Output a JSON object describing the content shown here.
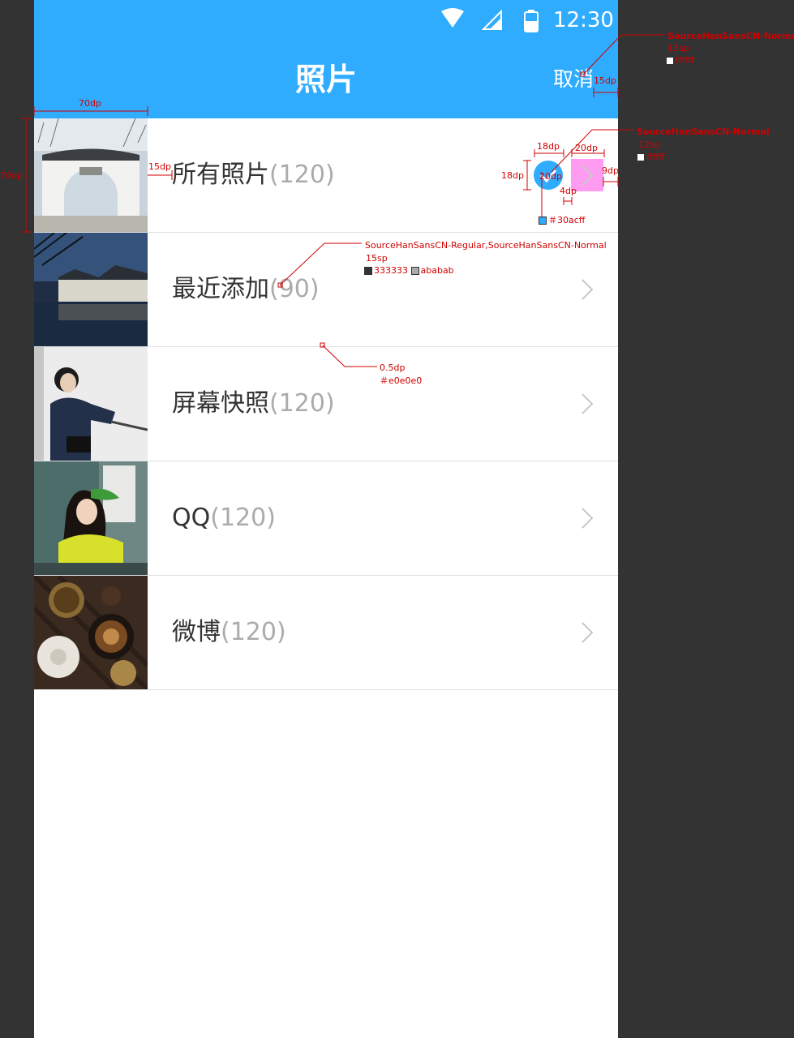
{
  "status_bar": {
    "time": "12:30",
    "icons": [
      "wifi-icon",
      "signal-icon",
      "battery-icon"
    ]
  },
  "header": {
    "title": "照片",
    "cancel_label": "取消"
  },
  "colors": {
    "accent": "#30acff",
    "primary_text": "#333333",
    "secondary_text": "#ababab",
    "divider": "#e0e0e0",
    "header_text": "#ffffff"
  },
  "albums": [
    {
      "name": "所有照片",
      "count": "(120)",
      "selected": true
    },
    {
      "name": "最近添加",
      "count": "(90)",
      "selected": false
    },
    {
      "name": "屏幕快照",
      "count": "(120)",
      "selected": false
    },
    {
      "name": "QQ",
      "count": "(120)",
      "selected": false
    },
    {
      "name": "微博",
      "count": "(120)",
      "selected": false
    }
  ],
  "annotations": {
    "cancel_font": "SourceHanSansCN-Normal",
    "cancel_size": "13sp",
    "cancel_color": "ffffff",
    "badge_font": "SourceHanSansCN-Normal",
    "badge_size": "12sp",
    "badge_color": "ffffff",
    "row_font": "SourceHanSansCN-Regular,SourceHanSansCN-Normal",
    "row_size": "15sp",
    "row_color_primary": "333333",
    "row_color_secondary": "ababab",
    "divider_width": "0.5dp",
    "divider_color": "＃e0e0e0",
    "accent_color": "＃30acff",
    "dim_70dp_w": "70dp",
    "dim_70dp_h": "70dp",
    "dim_15dp_text": "15dp",
    "dim_15dp_cancel": "15dp",
    "dim_18dp_w": "18dp",
    "dim_18dp_h": "18dp",
    "dim_20dp_w": "20dp",
    "dim_20dp_h": "20dp",
    "dim_4dp": "4dp",
    "dim_9dp": "9dp"
  }
}
